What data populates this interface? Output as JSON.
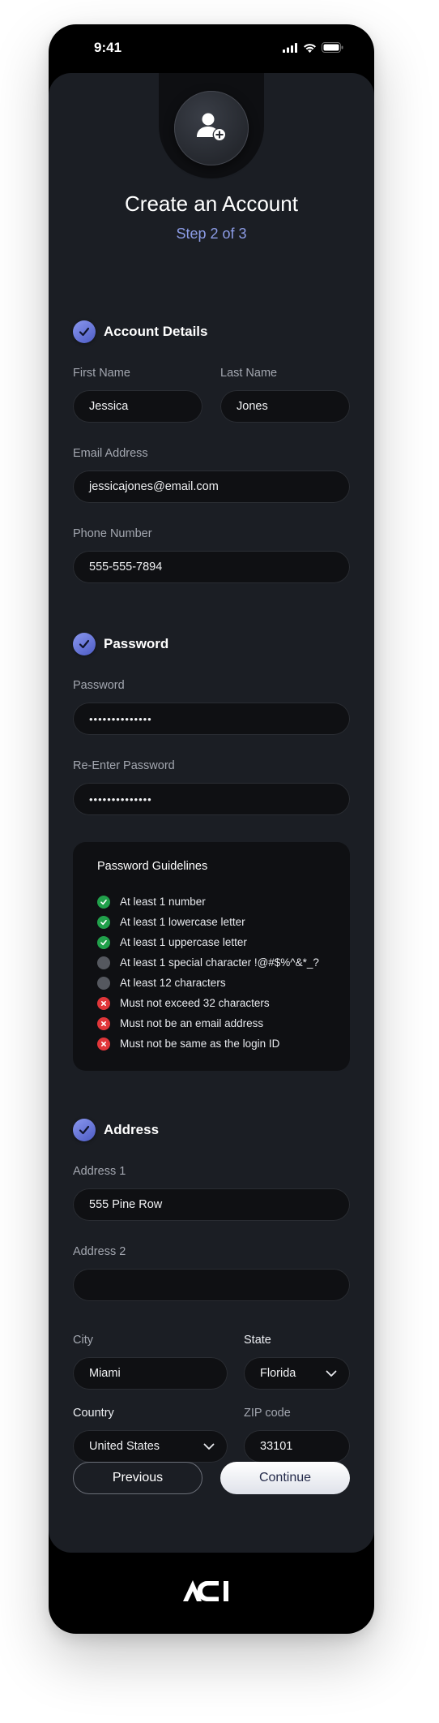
{
  "status_bar": {
    "time": "9:41"
  },
  "header": {
    "title": "Create an Account",
    "step": "Step 2 of 3"
  },
  "sections": {
    "account": {
      "title": "Account Details"
    },
    "password": {
      "title": "Password"
    },
    "address": {
      "title": "Address"
    }
  },
  "account": {
    "first_name": {
      "label": "First Name",
      "value": "Jessica"
    },
    "last_name": {
      "label": "Last Name",
      "value": "Jones"
    },
    "email": {
      "label": "Email Address",
      "value": "jessicajones@email.com"
    },
    "phone": {
      "label": "Phone Number",
      "value": "555-555-7894"
    }
  },
  "password": {
    "password": {
      "label": "Password",
      "value": "••••••••••••••"
    },
    "reenter": {
      "label": "Re-Enter Password",
      "value": "••••••••••••••"
    },
    "guidelines_title": "Password Guidelines",
    "guidelines": [
      {
        "text": "At least 1 number",
        "status": "pass"
      },
      {
        "text": "At least 1 lowercase letter",
        "status": "pass"
      },
      {
        "text": "At least 1 uppercase letter",
        "status": "pass"
      },
      {
        "text": "At least 1 special character !@#$%^&*_?",
        "status": "pending"
      },
      {
        "text": "At least 12 characters",
        "status": "pending"
      },
      {
        "text": "Must not exceed 32 characters",
        "status": "fail"
      },
      {
        "text": "Must not be an email address",
        "status": "fail"
      },
      {
        "text": "Must not be same as the login ID",
        "status": "fail"
      }
    ]
  },
  "address": {
    "address1": {
      "label": "Address 1",
      "value": "555 Pine Row"
    },
    "address2": {
      "label": "Address 2",
      "value": ""
    },
    "city": {
      "label": "City",
      "value": "Miami"
    },
    "state": {
      "label": "State",
      "value": "Florida"
    },
    "country": {
      "label": "Country",
      "value": "United States"
    },
    "zip": {
      "label": "ZIP code",
      "value": "33101"
    }
  },
  "buttons": {
    "previous": "Previous",
    "continue": "Continue"
  },
  "colors": {
    "accent": "#8c9ce6",
    "pass": "#21a04b",
    "pending": "#55585f",
    "fail": "#e0363a",
    "screen_bg": "#1b1e24",
    "field_bg": "#0f1013"
  },
  "icons": {
    "avatar": "user-add-icon",
    "section": "check-circle-icon",
    "select": "chevron-down-icon",
    "logo": "aci-logo"
  }
}
